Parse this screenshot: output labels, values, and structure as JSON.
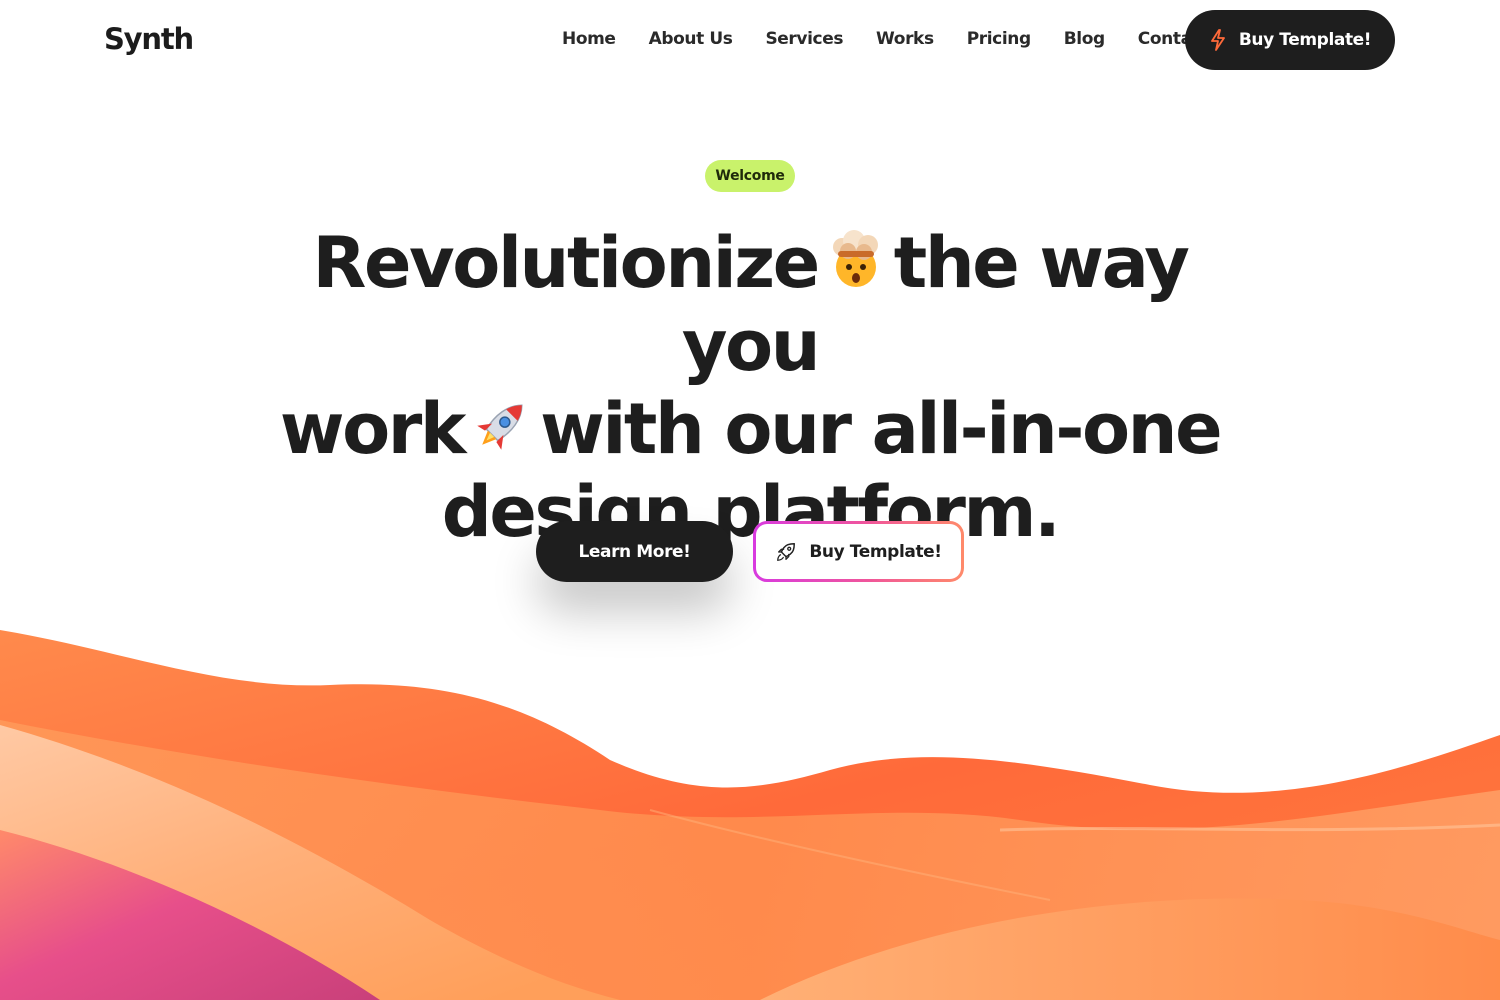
{
  "nav": {
    "logo": "Synth",
    "links": [
      "Home",
      "About Us",
      "Services",
      "Works",
      "Pricing",
      "Blog",
      "Contact"
    ],
    "cta_label": "Buy Template!",
    "cta_icon": "lightning-bolt-icon"
  },
  "hero": {
    "badge": "Welcome",
    "headline": {
      "part1": "Revolutionize",
      "emoji1": "exploding-head-emoji",
      "part2": "the way you",
      "part3": "work",
      "emoji2": "rocket-emoji",
      "part4": "with our all-in-one",
      "part5": "design platform."
    },
    "primary_cta": "Learn More!",
    "secondary_cta": "Buy Template!",
    "secondary_icon": "rocket-outline-icon"
  },
  "colors": {
    "dark": "#1e1e1e",
    "badge_bg": "#c9f26b",
    "gradient_start": "#d83ae0",
    "gradient_end": "#ff8a6a",
    "wave_orange": "#ff6a3a",
    "wave_pink": "#d63a8a"
  }
}
